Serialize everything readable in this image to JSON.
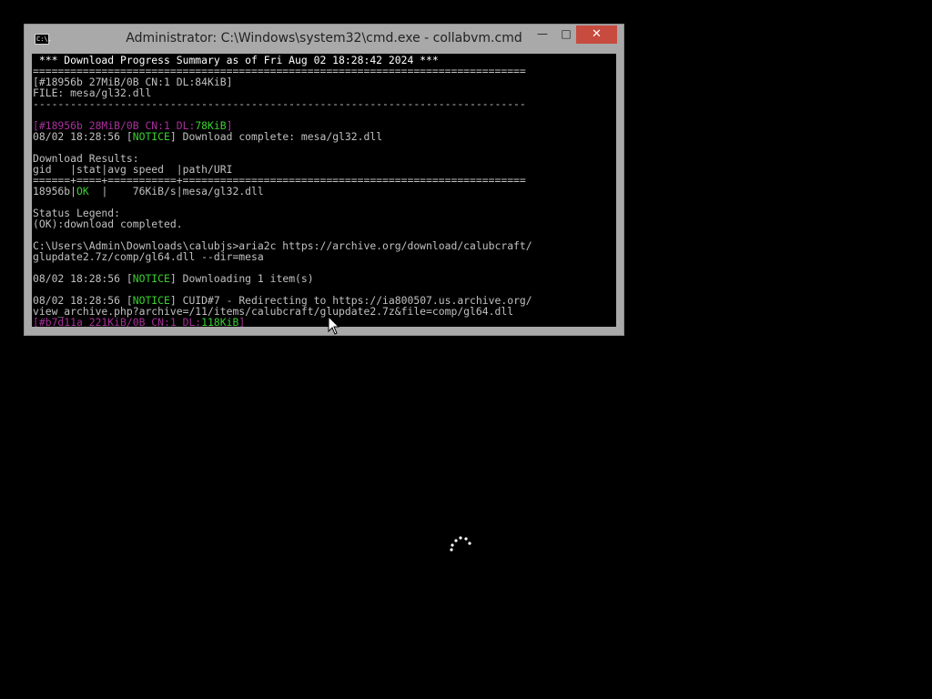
{
  "window": {
    "title": "Administrator: C:\\Windows\\system32\\cmd.exe - collabvm.cmd",
    "icon": "cmd-icon",
    "icon_text": "C:\\.",
    "controls": {
      "minimize": "—",
      "maximize": "□",
      "close": "✕"
    }
  },
  "console": {
    "l01": " *** Download Progress Summary as of Fri Aug 02 18:28:42 2024 *** ",
    "l02": "===============================================================================",
    "l03": "[#18956b 27MiB/0B CN:1 DL:84KiB]",
    "l04": "FILE: mesa/gl32.dll",
    "l05": "-------------------------------------------------------------------------------",
    "l06_a": "[#18956b 28MiB/0B CN:1 DL:",
    "l06_b": "78KiB",
    "l06_c": "]",
    "l07_a": "08/02 18:28:56 [",
    "l07_b": "NOTICE",
    "l07_c": "] Download complete: mesa/gl32.dll",
    "l08": "Download Results:",
    "l09": "gid   |stat|avg speed  |path/URI",
    "l10": "======+====+===========+=======================================================",
    "l11_a": "18956b|",
    "l11_b": "OK",
    "l11_c": "  |    76KiB/s|mesa/gl32.dll",
    "l12": "Status Legend:",
    "l13": "(OK):download completed.",
    "l14": "C:\\Users\\Admin\\Downloads\\calubjs>aria2c https://archive.org/download/calubcraft/",
    "l15": "glupdate2.7z/comp/gl64.dll --dir=mesa",
    "l16_a": "08/02 18:28:56 [",
    "l16_b": "NOTICE",
    "l16_c": "] Downloading 1 item(s)",
    "l17_a": "08/02 18:28:56 [",
    "l17_b": "NOTICE",
    "l17_c": "] CUID#7 - Redirecting to https://ia800507.us.archive.org/",
    "l18": "view_archive.php?archive=/11/items/calubcraft/glupdate2.7z&file=comp/gl64.dll",
    "l19_a": "[#b7d11a 221KiB/0B CN:1 DL:",
    "l19_b": "118KiB",
    "l19_c": "]"
  },
  "desktop": {
    "cursor_icon": "mouse-pointer-icon",
    "spinner_icon": "loading-spinner-icon"
  },
  "colors": {
    "console_background": "#000000",
    "console_text": "#c0c0c0",
    "notice_green": "#39d22f",
    "bracket_purple": "#a8309a",
    "close_button_red": "#c74b3f",
    "window_frame": "#a9a9a9"
  }
}
